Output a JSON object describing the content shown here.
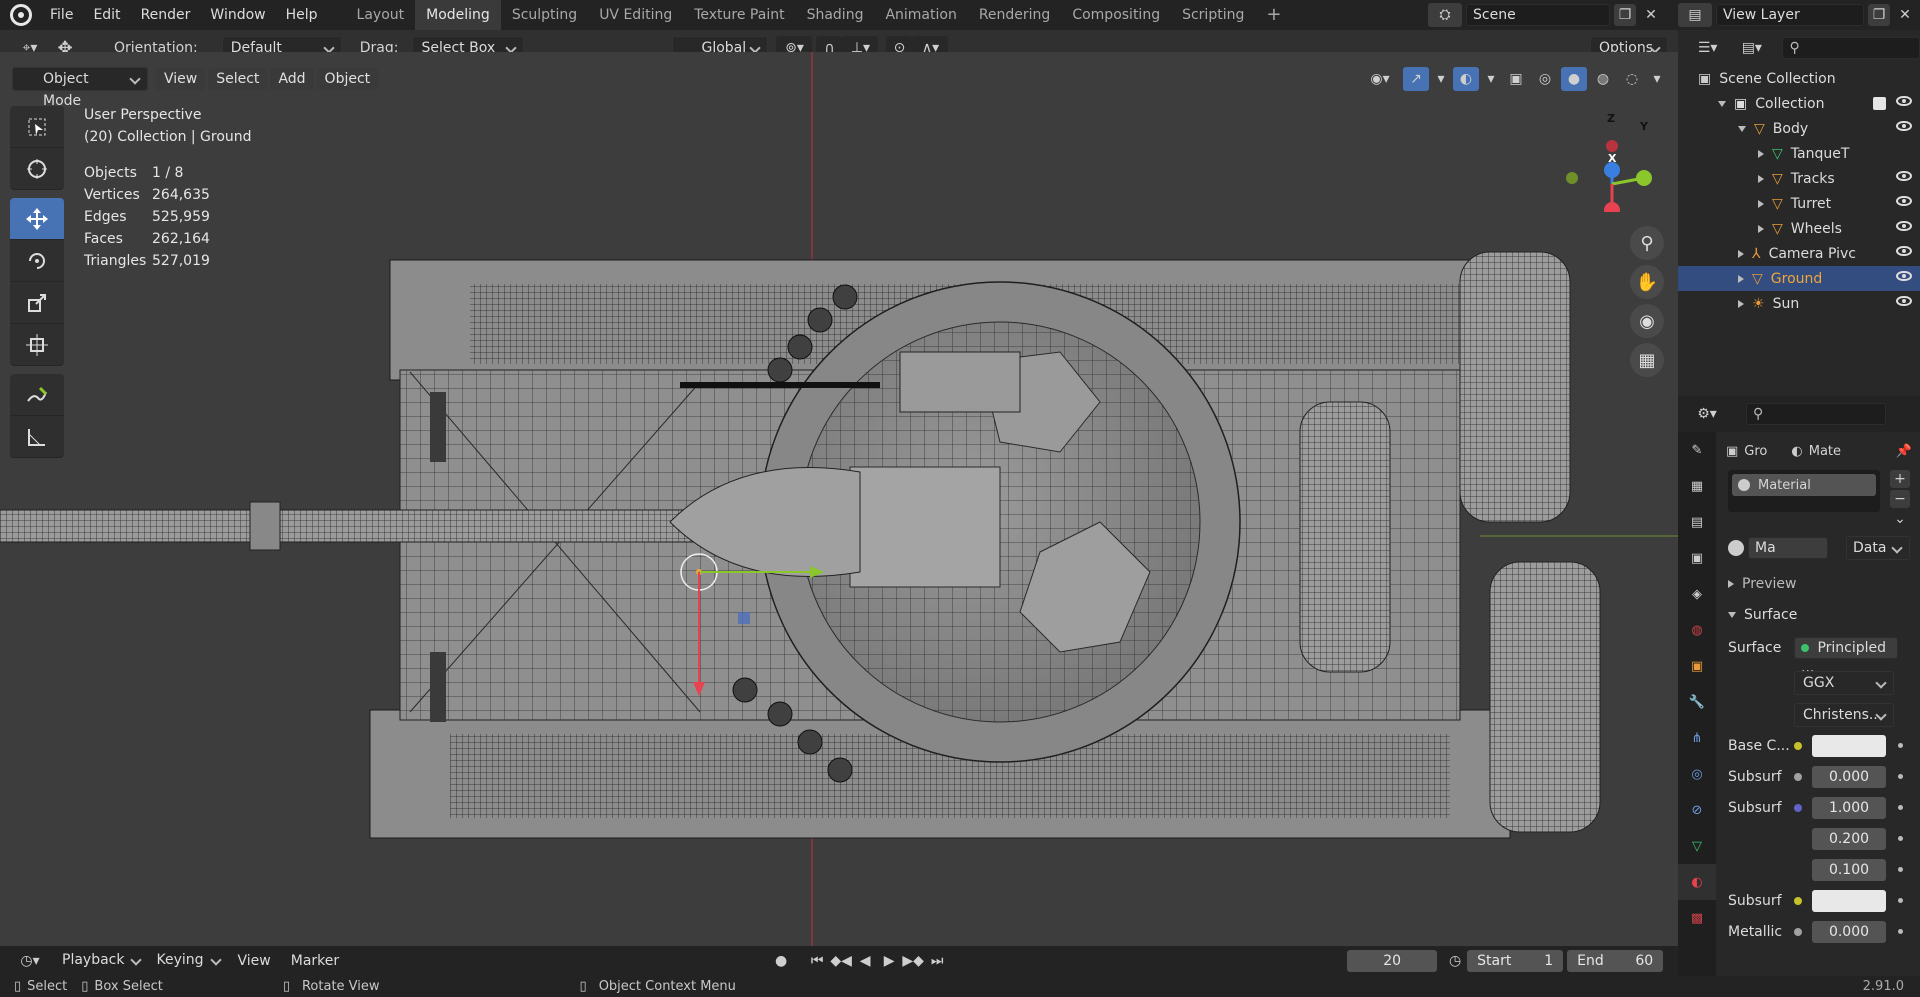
{
  "topbar": {
    "menus": [
      "File",
      "Edit",
      "Render",
      "Window",
      "Help"
    ],
    "workspaces": [
      "Layout",
      "Modeling",
      "Sculpting",
      "UV Editing",
      "Texture Paint",
      "Shading",
      "Animation",
      "Rendering",
      "Compositing",
      "Scripting"
    ],
    "active_workspace": "Modeling",
    "scene": "Scene",
    "view_layer": "View Layer"
  },
  "toolheader": {
    "orientation_label": "Orientation:",
    "orientation_value": "Default",
    "drag_label": "Drag:",
    "drag_value": "Select Box",
    "transform_orientation": "Global",
    "options_label": "Options"
  },
  "viewport_header": {
    "mode": "Object Mode",
    "menus": [
      "View",
      "Select",
      "Add",
      "Object"
    ]
  },
  "overlay": {
    "view_name": "User Perspective",
    "context": "(20) Collection | Ground",
    "stats": [
      {
        "label": "Objects",
        "value": "1 / 8"
      },
      {
        "label": "Vertices",
        "value": "264,635"
      },
      {
        "label": "Edges",
        "value": "525,959"
      },
      {
        "label": "Faces",
        "value": "262,164"
      },
      {
        "label": "Triangles",
        "value": "527,019"
      }
    ],
    "gizmo_axes": {
      "x": "X",
      "y": "Y",
      "z": "Z"
    }
  },
  "outliner": {
    "root": "Scene Collection",
    "rows": [
      {
        "label": "Collection",
        "indent": 1,
        "icon": "collection-icon",
        "expanded": true,
        "eye": true
      },
      {
        "label": "Body",
        "indent": 2,
        "icon": "object-icon",
        "expanded": true,
        "eye": true
      },
      {
        "label": "TanqueT",
        "indent": 3,
        "icon": "mesh-icon",
        "expanded": false,
        "eye": false
      },
      {
        "label": "Tracks",
        "indent": 3,
        "icon": "object-icon",
        "expanded": false,
        "eye": true
      },
      {
        "label": "Turret",
        "indent": 3,
        "icon": "object-icon",
        "expanded": false,
        "eye": true
      },
      {
        "label": "Wheels",
        "indent": 3,
        "icon": "object-icon",
        "expanded": false,
        "eye": true
      },
      {
        "label": "Camera Pivc",
        "indent": 2,
        "icon": "empty-icon",
        "expanded": false,
        "eye": true
      },
      {
        "label": "Ground",
        "indent": 2,
        "icon": "object-icon",
        "expanded": false,
        "eye": true,
        "selected": true
      },
      {
        "label": "Sun",
        "indent": 2,
        "icon": "light-icon",
        "expanded": false,
        "eye": true
      }
    ]
  },
  "properties": {
    "object_short": "Gro",
    "material_short": "Mate",
    "slot_name": "Material",
    "mat_short": "Ma",
    "data_label": "Data",
    "preview_label": "Preview",
    "surface_header": "Surface",
    "surface_label": "Surface",
    "surface_value": "Principled ...",
    "distribution": "GGX",
    "subsurface_method": "Christens...",
    "fields": [
      {
        "label": "Base C...",
        "value": "",
        "dot": "#c7c229",
        "swatch": true
      },
      {
        "label": "Subsurf",
        "value": "0.000",
        "dot": "#a1a1a1",
        "swatch": false
      },
      {
        "label": "Subsurf",
        "value": "1.000",
        "dot": "#6363c7",
        "swatch": false
      },
      {
        "label": "",
        "value": "0.200",
        "dot": "",
        "swatch": false
      },
      {
        "label": "",
        "value": "0.100",
        "dot": "",
        "swatch": false
      },
      {
        "label": "Subsurf",
        "value": "",
        "dot": "#c7c229",
        "swatch": true
      },
      {
        "label": "Metallic",
        "value": "0.000",
        "dot": "#a1a1a1",
        "swatch": false
      }
    ]
  },
  "timeline": {
    "menus": [
      "Playback",
      "Keying",
      "View",
      "Marker"
    ],
    "current_frame": "20",
    "start_label": "Start",
    "start_value": "1",
    "end_label": "End",
    "end_value": "60"
  },
  "statusbar": {
    "select": "Select",
    "box_select": "Box Select",
    "rotate": "Rotate View",
    "context_menu": "Object Context Menu",
    "version": "2.91.0"
  },
  "colors": {
    "accent": "#4772b3",
    "selected_row": "#334d80",
    "axis_x": "#e8414f",
    "axis_y": "#8bc72a",
    "axis_z": "#3a7fe0"
  }
}
